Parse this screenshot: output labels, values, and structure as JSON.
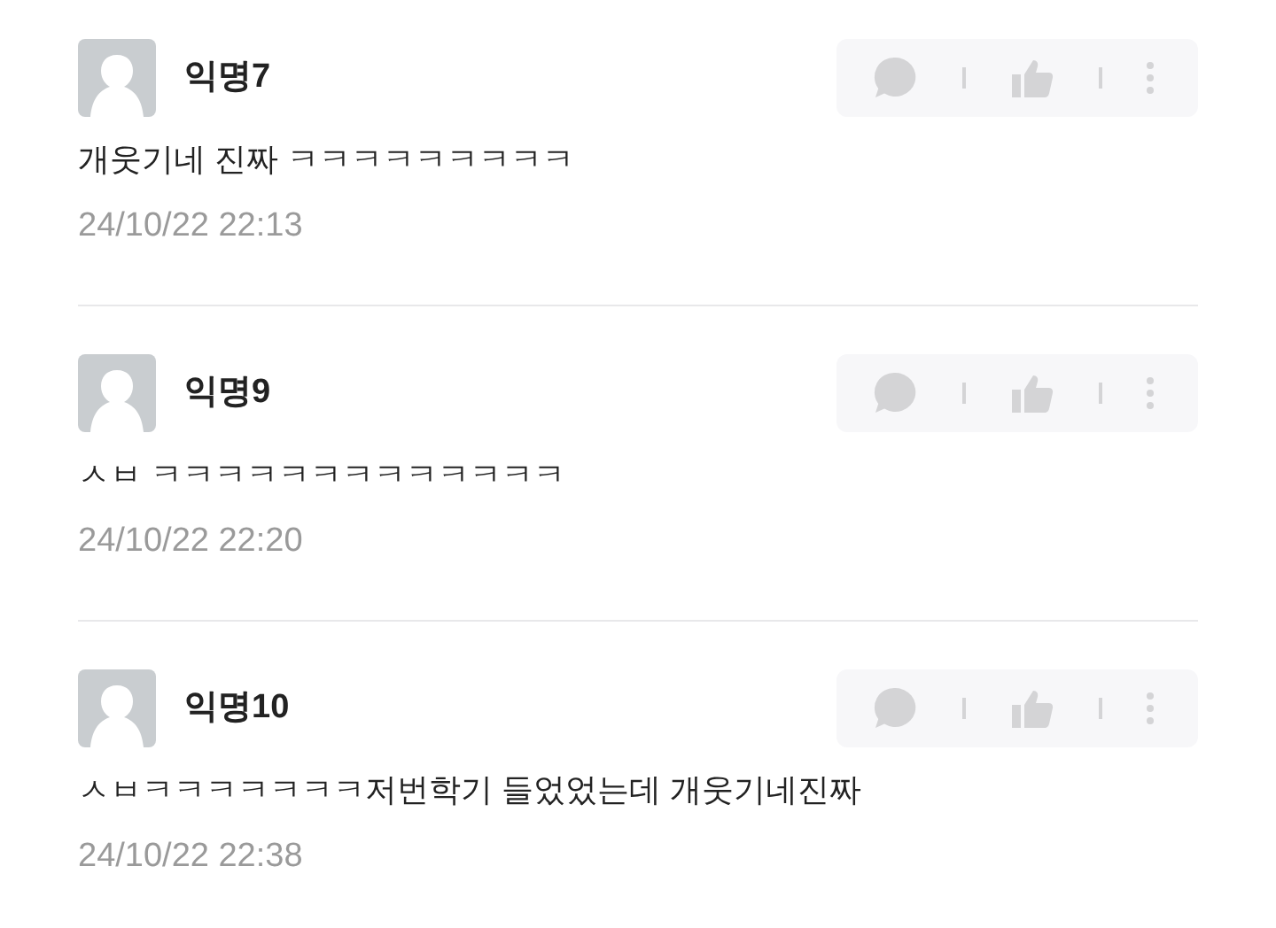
{
  "comments": [
    {
      "author": "익명7",
      "text": "개웃기네 진짜 ㅋㅋㅋㅋㅋㅋㅋㅋㅋ",
      "date": "24/10/22 22:13"
    },
    {
      "author": "익명9",
      "text": "ㅅㅂ ㅋㅋㅋㅋㅋㅋㅋㅋㅋㅋㅋㅋㅋ",
      "date": "24/10/22 22:20"
    },
    {
      "author": "익명10",
      "text": "ㅅㅂㅋㅋㅋㅋㅋㅋㅋ저번학기 들었었는데 개웃기네진짜",
      "date": "24/10/22 22:38"
    }
  ]
}
